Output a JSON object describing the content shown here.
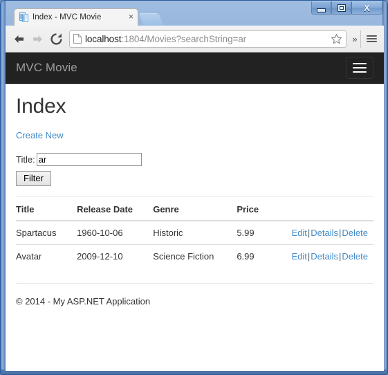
{
  "window": {
    "buttons": {
      "minimize": "minimize",
      "maximize": "maximize",
      "close": "X"
    }
  },
  "browser": {
    "tab": {
      "title": "Index - MVC Movie",
      "close_label": "×",
      "favicon": "page-icon"
    },
    "newtab_label": "",
    "back_label": "←",
    "forward_label": "→",
    "reload_label": "⟳",
    "url": {
      "host": "localhost",
      "path": ":1804/Movies?searchString=ar",
      "full": "localhost:1804/Movies?searchString=ar"
    },
    "star_label": "☆",
    "overflow_label": "»",
    "menu_label": "menu"
  },
  "page": {
    "navbar": {
      "brand": "MVC Movie",
      "toggle_label": "Toggle navigation"
    },
    "heading": "Index",
    "create_link": "Create New",
    "filter_form": {
      "label": "Title:",
      "input_value": "ar",
      "input_placeholder": "",
      "button_label": "Filter"
    },
    "table": {
      "headers": [
        "Title",
        "Release Date",
        "Genre",
        "Price",
        ""
      ],
      "rows": [
        {
          "title": "Spartacus",
          "release_date": "1960-10-06",
          "genre": "Historic",
          "price": "5.99",
          "actions": {
            "edit": "Edit",
            "details": "Details",
            "delete": "Delete",
            "separator": "|"
          }
        },
        {
          "title": "Avatar",
          "release_date": "2009-12-10",
          "genre": "Science Fiction",
          "price": "6.99",
          "actions": {
            "edit": "Edit",
            "details": "Details",
            "delete": "Delete",
            "separator": "|"
          }
        }
      ]
    },
    "footer": "© 2014 - My ASP.NET Application"
  },
  "colors": {
    "navbar_bg": "#222222",
    "brand_text": "#9d9d9d",
    "link": "#428bca",
    "body_text": "#333333",
    "frame_blue": "#4e7cb8"
  }
}
